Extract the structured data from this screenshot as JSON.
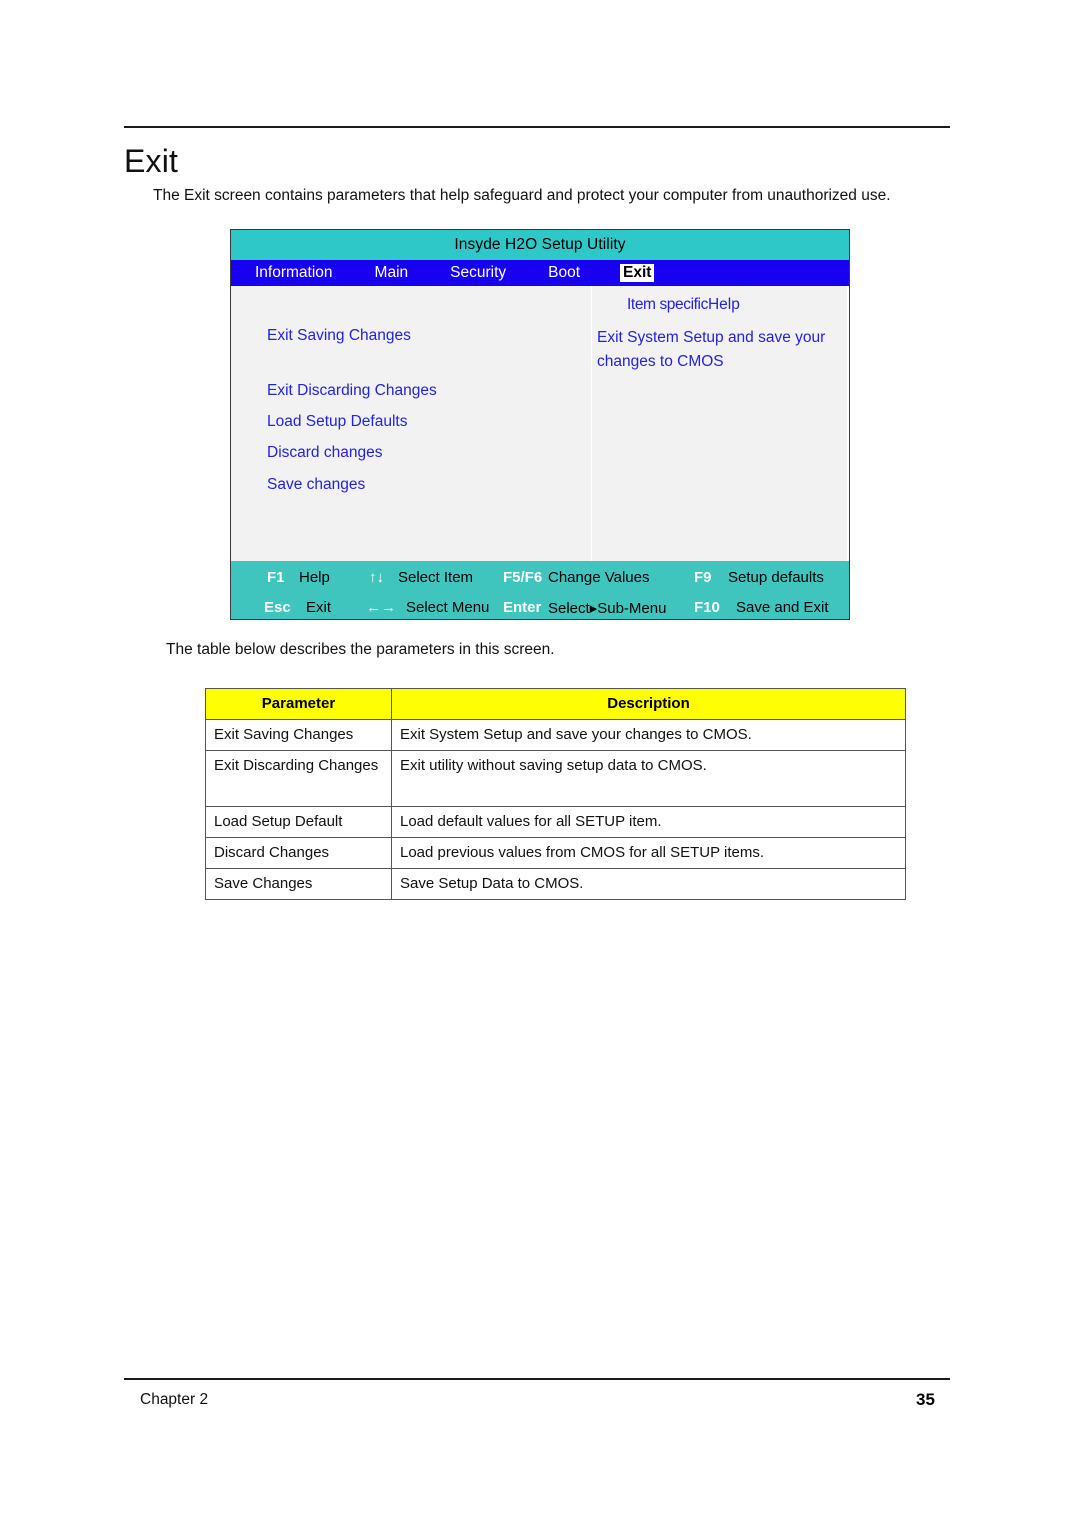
{
  "document": {
    "heading": "Exit",
    "intro": "The Exit screen contains parameters that help safeguard and protect your computer from unauthorized use.",
    "mid_text": "The table below describes the parameters in this screen.",
    "footer_left": "Chapter 2",
    "footer_right": "35"
  },
  "bios": {
    "title": "Insyde H2O Setup Utility",
    "nav": [
      {
        "label": "Information",
        "selected": false
      },
      {
        "label": "Main",
        "selected": false
      },
      {
        "label": "Security",
        "selected": false
      },
      {
        "label": "Boot",
        "selected": false
      },
      {
        "label": "Exit",
        "selected": true
      }
    ],
    "menu_items": [
      {
        "label": "Exit Saving Changes"
      },
      {
        "label": "Exit Discarding Changes"
      },
      {
        "label": "Load Setup Defaults"
      },
      {
        "label": "Discard changes"
      },
      {
        "label": "Save changes"
      }
    ],
    "help": {
      "title_part1": "Item specific",
      "title_part2": "Help",
      "text": "Exit System Setup and save your changes to CMOS"
    },
    "footer_keys": [
      {
        "key": "F1",
        "desc": "Help"
      },
      {
        "key": "↑↓",
        "desc": "Select Item"
      },
      {
        "key": "F5/F6",
        "desc": "Change Values"
      },
      {
        "key": "F9",
        "desc": "Setup defaults"
      },
      {
        "key": "Esc",
        "desc": "Exit"
      },
      {
        "key": "←→",
        "desc": "Select Menu"
      },
      {
        "key": "Enter",
        "desc": "Select▸Sub-Menu"
      },
      {
        "key": "F10",
        "desc": "Save and Exit"
      }
    ],
    "colors": {
      "title_bar": "#2EC8C8",
      "nav_bar": "#1800F0",
      "body": "#F2F2F2",
      "footer_bar": "#3FC4BE",
      "menu_text": "#2222E0"
    }
  },
  "table": {
    "headers": [
      "Parameter",
      "Description"
    ],
    "rows": [
      {
        "parameter": "Exit Saving Changes",
        "description": "Exit System Setup and save your changes to CMOS."
      },
      {
        "parameter": "Exit Discarding Changes",
        "description": "Exit utility without saving setup data to CMOS."
      },
      {
        "parameter": "Load Setup Default",
        "description": "Load default values for all SETUP item."
      },
      {
        "parameter": "Discard Changes",
        "description": "Load previous values from CMOS for all SETUP items."
      },
      {
        "parameter": "Save Changes",
        "description": "Save Setup Data to CMOS."
      }
    ]
  }
}
